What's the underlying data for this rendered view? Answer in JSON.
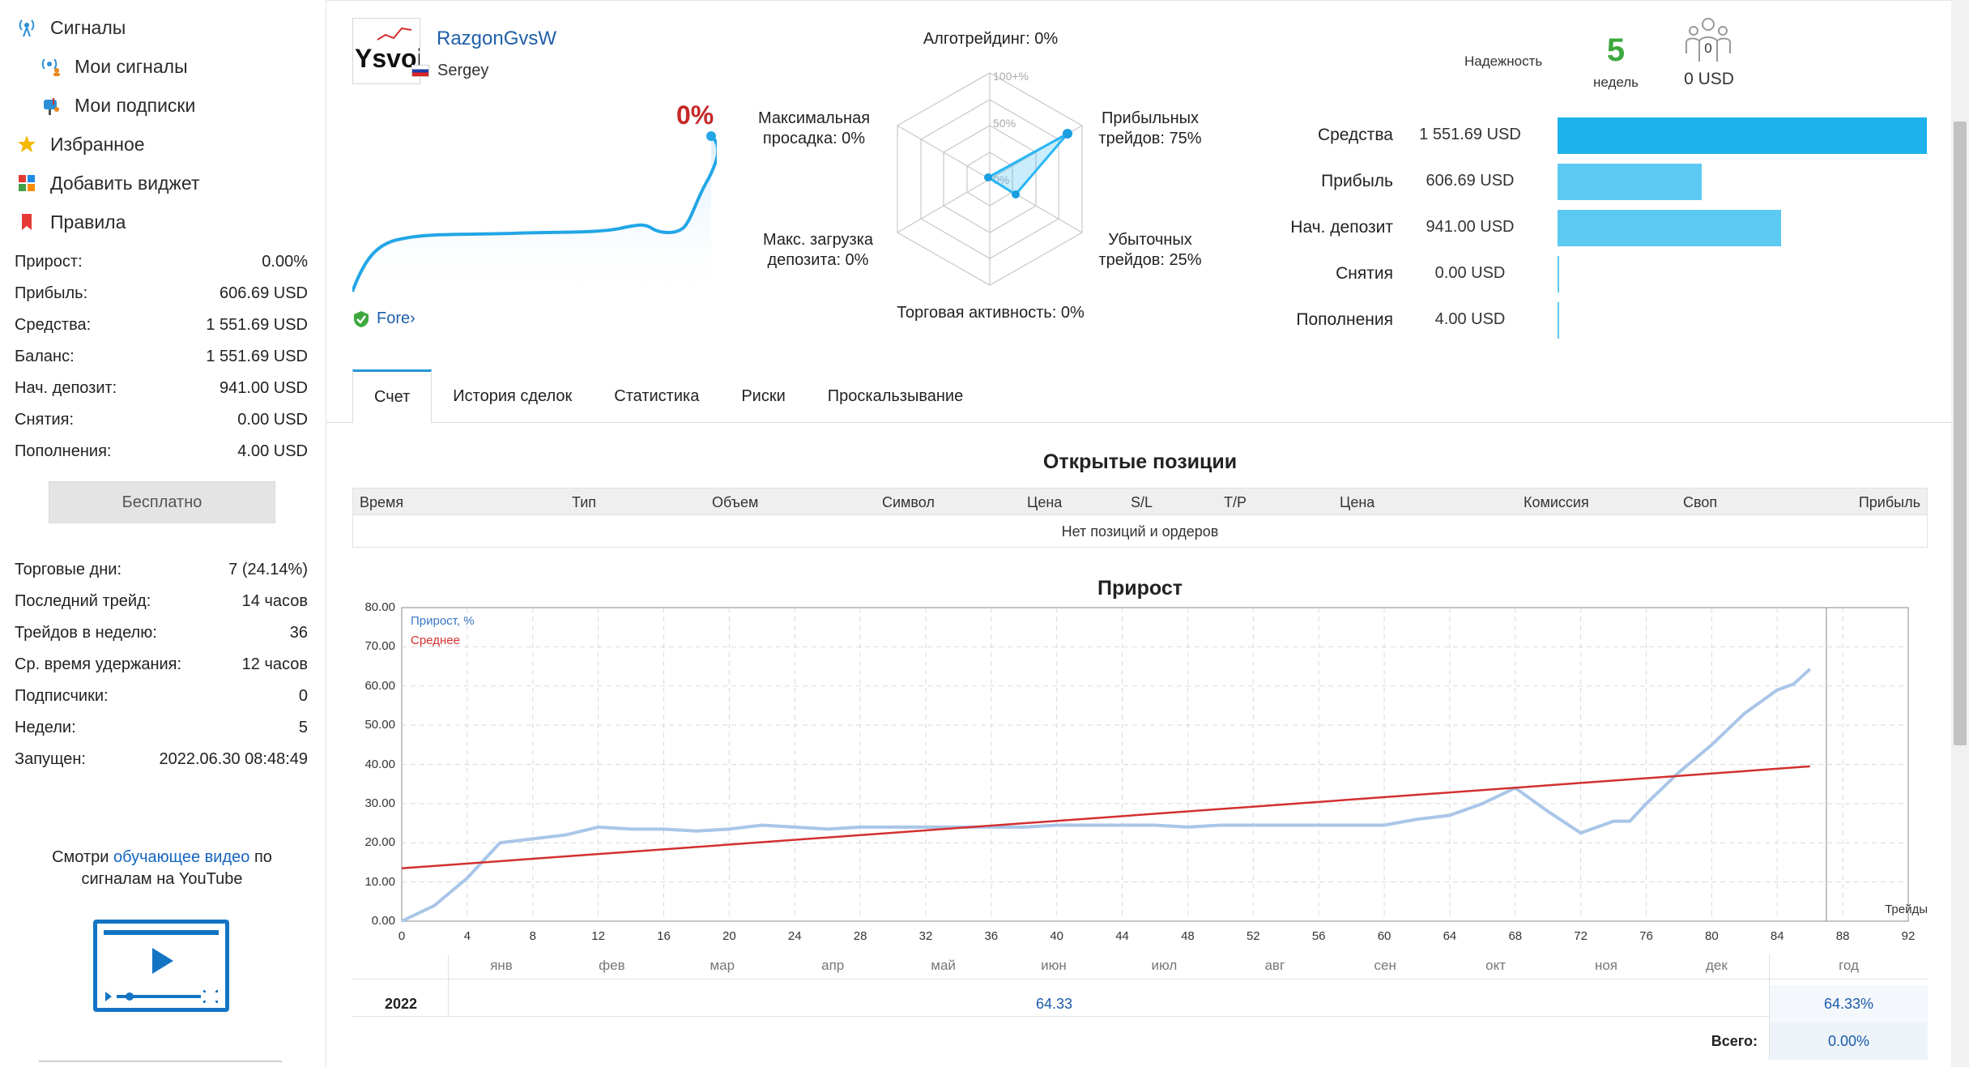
{
  "sidebar": {
    "nav": {
      "signals": "Сигналы",
      "my_signals": "Мои сигналы",
      "my_subscriptions": "Мои подписки",
      "favorites": "Избранное",
      "add_widget": "Добавить виджет",
      "rules": "Правила"
    },
    "stats1": [
      {
        "label": "Прирост:",
        "value": "0.00%"
      },
      {
        "label": "Прибыль:",
        "value": "606.69 USD"
      },
      {
        "label": "Средства:",
        "value": "1 551.69 USD"
      },
      {
        "label": "Баланс:",
        "value": "1 551.69 USD"
      },
      {
        "label": "Нач. депозит:",
        "value": "941.00 USD"
      },
      {
        "label": "Снятия:",
        "value": "0.00 USD"
      },
      {
        "label": "Пополнения:",
        "value": "4.00 USD"
      }
    ],
    "free_button": "Бесплатно",
    "stats2": [
      {
        "label": "Торговые дни:",
        "value": "7 (24.14%)"
      },
      {
        "label": "Последний трейд:",
        "value": "14 часов"
      },
      {
        "label": "Трейдов в неделю:",
        "value": "36"
      },
      {
        "label": "Ср. время удержания:",
        "value": "12 часов"
      },
      {
        "label": "Подписчики:",
        "value": "0"
      },
      {
        "label": "Недели:",
        "value": "5"
      },
      {
        "label": "Запущен:",
        "value": "2022.06.30 08:48:49"
      }
    ],
    "tutorial": {
      "before": "Смотри ",
      "link": "обучающее видео",
      "after": " по сигналам на YouTube"
    }
  },
  "header": {
    "logo_text": "Ysvoi",
    "provider_name": "RazgonGvsW",
    "author": "Sergey",
    "growth": "0%",
    "badge": "Fore›"
  },
  "radar": {
    "algo": "Алготрейдинг: 0%",
    "scale_100": "100+%",
    "scale_50": "50%",
    "scale_0": "0%",
    "max_dd_line1": "Максимальная",
    "max_dd_line2": "просадка: 0%",
    "profit_line1": "Прибыльных",
    "profit_line2": "трейдов: 75%",
    "max_load_line1": "Макс. загрузка",
    "max_load_line2": "депозита: 0%",
    "loss_line1": "Убыточных",
    "loss_line2": "трейдов: 25%",
    "activity": "Торговая активность: 0%"
  },
  "reliability": {
    "label": "Надежность",
    "weeks": "5",
    "weeks_label": "недель",
    "subscribers": "0",
    "subs_usd": "0 USD"
  },
  "finance": [
    {
      "label": "Средства",
      "value": "1 551.69 USD",
      "fraction": 1.0
    },
    {
      "label": "Прибыль",
      "value": "606.69 USD",
      "fraction": 0.391
    },
    {
      "label": "Нач. депозит",
      "value": "941.00 USD",
      "fraction": 0.606
    },
    {
      "label": "Снятия",
      "value": "0.00 USD",
      "fraction": 0
    },
    {
      "label": "Пополнения",
      "value": "4.00 USD",
      "fraction": 0.003
    }
  ],
  "tabs": [
    "Счет",
    "История сделок",
    "Статистика",
    "Риски",
    "Проскальзывание"
  ],
  "open_positions": {
    "title": "Открытые позиции",
    "columns": [
      "Время",
      "Тип",
      "Объем",
      "Символ",
      "Цена",
      "S/L",
      "T/P",
      "Цена",
      "Комиссия",
      "Своп",
      "Прибыль"
    ],
    "empty": "Нет позиций и ордеров"
  },
  "chart_data": {
    "type": "line",
    "title": "Прирост",
    "xlabel": "Трейды",
    "ylabel": "",
    "xlim": [
      0,
      92
    ],
    "ylim": [
      0,
      80
    ],
    "x_ticks": [
      0,
      4,
      8,
      12,
      16,
      20,
      24,
      28,
      32,
      36,
      40,
      44,
      48,
      52,
      56,
      60,
      64,
      68,
      72,
      76,
      80,
      84,
      88,
      92
    ],
    "y_ticks": [
      "0.00",
      "10.00",
      "20.00",
      "30.00",
      "40.00",
      "50.00",
      "60.00",
      "70.00",
      "80.00"
    ],
    "legend_position": "top-left",
    "grid": true,
    "series": [
      {
        "name": "Прирост, %",
        "color": "#a9c6e8",
        "points": [
          [
            0,
            0
          ],
          [
            2,
            4
          ],
          [
            4,
            11
          ],
          [
            6,
            20
          ],
          [
            8,
            21
          ],
          [
            10,
            22
          ],
          [
            12,
            24
          ],
          [
            14,
            23.5
          ],
          [
            16,
            23.5
          ],
          [
            18,
            23
          ],
          [
            20,
            23.5
          ],
          [
            22,
            24.5
          ],
          [
            24,
            24
          ],
          [
            26,
            23.5
          ],
          [
            28,
            24
          ],
          [
            30,
            24
          ],
          [
            32,
            24
          ],
          [
            34,
            24
          ],
          [
            36,
            24
          ],
          [
            38,
            24
          ],
          [
            40,
            24.5
          ],
          [
            42,
            24.5
          ],
          [
            44,
            24.5
          ],
          [
            46,
            24.5
          ],
          [
            48,
            24
          ],
          [
            50,
            24.5
          ],
          [
            52,
            24.5
          ],
          [
            54,
            24.5
          ],
          [
            56,
            24.5
          ],
          [
            58,
            24.5
          ],
          [
            60,
            24.5
          ],
          [
            62,
            26
          ],
          [
            64,
            27
          ],
          [
            66,
            30
          ],
          [
            68,
            34
          ],
          [
            70,
            28
          ],
          [
            72,
            22.5
          ],
          [
            74,
            25.5
          ],
          [
            75,
            25.5
          ],
          [
            76,
            30
          ],
          [
            78,
            38
          ],
          [
            80,
            45
          ],
          [
            82,
            53
          ],
          [
            84,
            59
          ],
          [
            85,
            60.5
          ],
          [
            86,
            64.33
          ]
        ]
      },
      {
        "name": "Среднее",
        "color": "#d32f2f",
        "points": [
          [
            0,
            13.5
          ],
          [
            86,
            39.5
          ]
        ]
      }
    ]
  },
  "monthly": {
    "months": [
      "янв",
      "фев",
      "мар",
      "апр",
      "май",
      "июн",
      "июл",
      "авг",
      "сен",
      "окт",
      "ноя",
      "дек"
    ],
    "year_header": "год",
    "year": "2022",
    "jun_value": "64.33",
    "year_total": "64.33%",
    "total_label": "Всего:",
    "total_value": "0.00%"
  },
  "colors": {
    "accent": "#2596d6",
    "bar": "#5cc9f2",
    "growth_red": "#c62828",
    "reliability_green": "#3ea83e",
    "link": "#1f5fa8"
  }
}
